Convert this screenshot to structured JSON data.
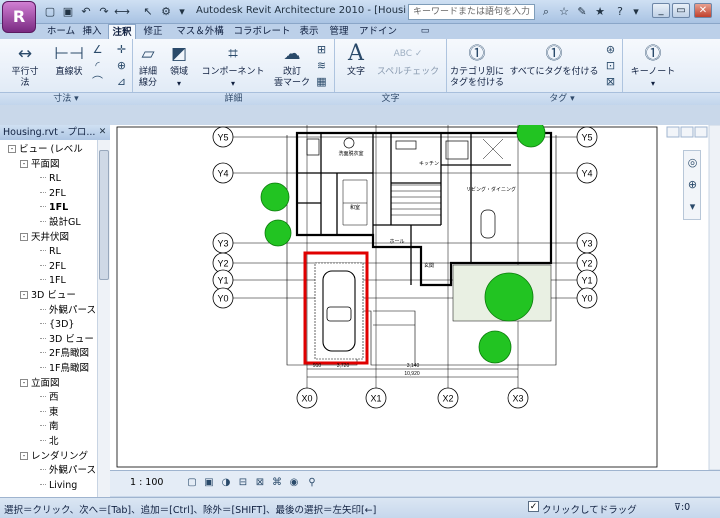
{
  "app": {
    "title": "Autodesk Revit Architecture 2010 - [Housing.rvt...",
    "search_placeholder": "キーワードまたは語句を入力",
    "app_button": "R"
  },
  "tabs": [
    {
      "label": "ホーム"
    },
    {
      "label": "挿入"
    },
    {
      "label": "注釈",
      "active": true
    },
    {
      "label": "修正"
    },
    {
      "label": "マス＆外構"
    },
    {
      "label": "コラボレート"
    },
    {
      "label": "表示"
    },
    {
      "label": "管理"
    },
    {
      "label": "アドイン"
    }
  ],
  "ribbon": {
    "dimension": {
      "aligned": "平行寸法",
      "linear": "直線状",
      "panel": "寸法 ▾"
    },
    "detail": {
      "detail_line_1": "詳細",
      "detail_line_2": "線分",
      "region": "領域",
      "component": "コンポーネント",
      "revision_cloud_1": "改訂",
      "revision_cloud_2": "雲マーク",
      "panel": "詳細"
    },
    "text": {
      "text": "文字",
      "spell_check": "スペルチェック",
      "panel": "文字"
    },
    "tag": {
      "tag_by_category_1": "カテゴリ別に",
      "tag_by_category_2": "タグを付ける",
      "tag_all": "すべてにタグを付ける",
      "keynote": "キーノート",
      "panel": "タグ ▾"
    }
  },
  "browser": {
    "title": "Housing.rvt - プロ...",
    "items": [
      {
        "label": "ビュー (レベル",
        "toggle": "-",
        "level": 0,
        "icon": true
      },
      {
        "label": "平面図",
        "toggle": "-",
        "level": 1
      },
      {
        "label": "RL",
        "level": 2
      },
      {
        "label": "2FL",
        "level": 2
      },
      {
        "label": "1FL",
        "level": 2,
        "bold": true
      },
      {
        "label": "設計GL",
        "level": 2
      },
      {
        "label": "天井伏図",
        "toggle": "-",
        "level": 1
      },
      {
        "label": "RL",
        "level": 2
      },
      {
        "label": "2FL",
        "level": 2
      },
      {
        "label": "1FL",
        "level": 2
      },
      {
        "label": "3D ビュー",
        "toggle": "-",
        "level": 1
      },
      {
        "label": "外観パース",
        "level": 2
      },
      {
        "label": "{3D}",
        "level": 2
      },
      {
        "label": "3D ビュー",
        "level": 2
      },
      {
        "label": "2F鳥瞰図",
        "level": 2
      },
      {
        "label": "1F鳥瞰図",
        "level": 2
      },
      {
        "label": "立面図",
        "toggle": "-",
        "level": 1
      },
      {
        "label": "西",
        "level": 2
      },
      {
        "label": "東",
        "level": 2
      },
      {
        "label": "南",
        "level": 2
      },
      {
        "label": "北",
        "level": 2
      },
      {
        "label": "レンダリング",
        "toggle": "-",
        "level": 1
      },
      {
        "label": "外観パース",
        "level": 2
      },
      {
        "label": "Living",
        "level": 2
      }
    ]
  },
  "drawing": {
    "grid_rows": [
      "Y5",
      "Y4",
      "Y3",
      "Y2",
      "Y1",
      "Y0"
    ],
    "grid_cols": [
      "X0",
      "X1",
      "X2",
      "X3"
    ],
    "dimensions": [
      "910",
      "3,720",
      "3,140",
      "10,920"
    ],
    "rooms": [
      "洗面脱衣室",
      "キッチン",
      "リビング・ダイニング",
      "ホール",
      "玄関",
      "和室"
    ],
    "highlight_color": "#e00000",
    "tree_color": "#22c422"
  },
  "view_control": {
    "scale": "1 : 100"
  },
  "status": {
    "text": "選択＝クリック、次へ＝[Tab]、追加＝[Ctrl]、除外＝[SHIFT]、最後の選択＝左矢印[←]",
    "drag_label": "クリックしてドラッグ",
    "drag_checked": "✓",
    "filter": ":0"
  }
}
